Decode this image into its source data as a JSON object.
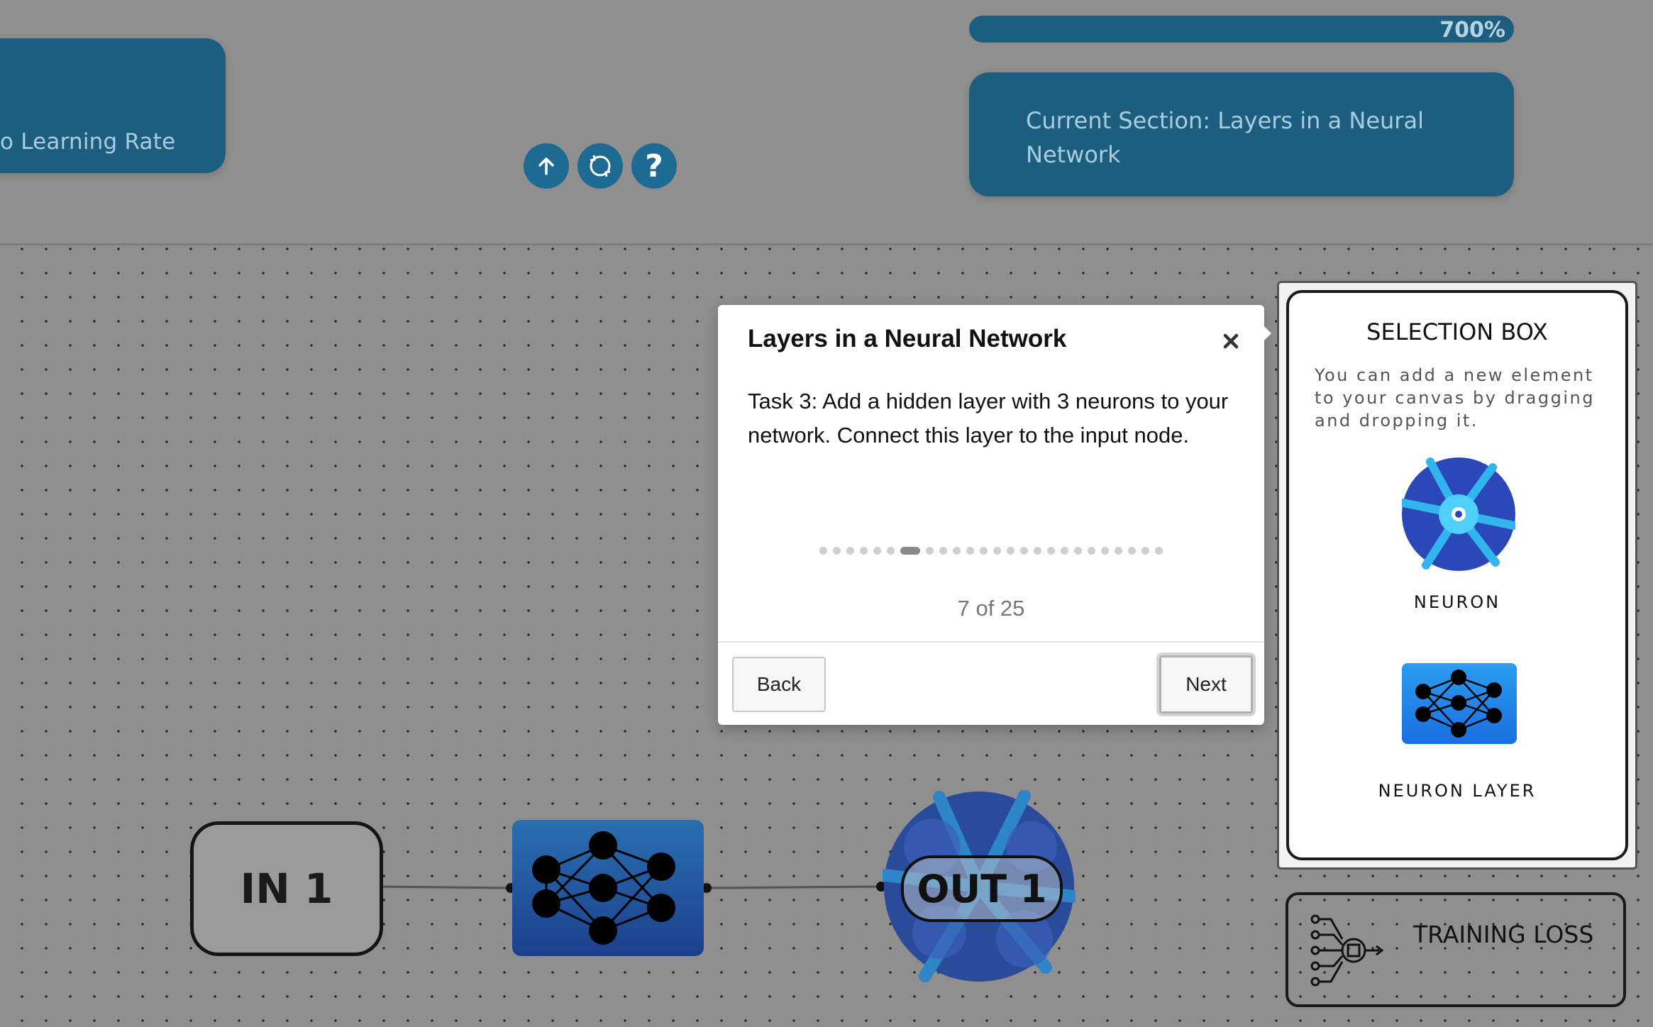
{
  "header": {
    "learning_rate_card": "o Learning Rate",
    "progress_label": "700%",
    "progress_fraction": 1.0,
    "current_section": "Current Section: Layers in a Neural Network"
  },
  "toolbar": {
    "icons": [
      "arrow-up-icon",
      "refresh-icon",
      "help-icon"
    ],
    "help_glyph": "?"
  },
  "dialog": {
    "title": "Layers in a Neural Network",
    "close_glyph": "×",
    "body": "Task 3: Add a hidden layer with 3 neurons to your network. Connect this layer to the input node.",
    "current_step": 7,
    "total_steps": 25,
    "counter": "7 of 25",
    "back_label": "Back",
    "next_label": "Next"
  },
  "selection_box": {
    "title": "SELECTION BOX",
    "description": "You can add a new element to your canvas by dragging and dropping it.",
    "items": [
      {
        "label": "NEURON",
        "icon": "neuron-icon"
      },
      {
        "label": "NEURON LAYER",
        "icon": "neuron-layer-icon"
      }
    ]
  },
  "training_loss": {
    "label": "TRAINING LOSS",
    "icon": "chip-circuit-icon"
  },
  "canvas": {
    "input_node": "IN 1",
    "layer_node_icon": "neural-network-icon",
    "output_node": "OUT 1"
  },
  "colors": {
    "accent": "#1d5e7f",
    "canvas_bg": "#8f8f8f",
    "layer_blue": "#1a6fe0"
  }
}
